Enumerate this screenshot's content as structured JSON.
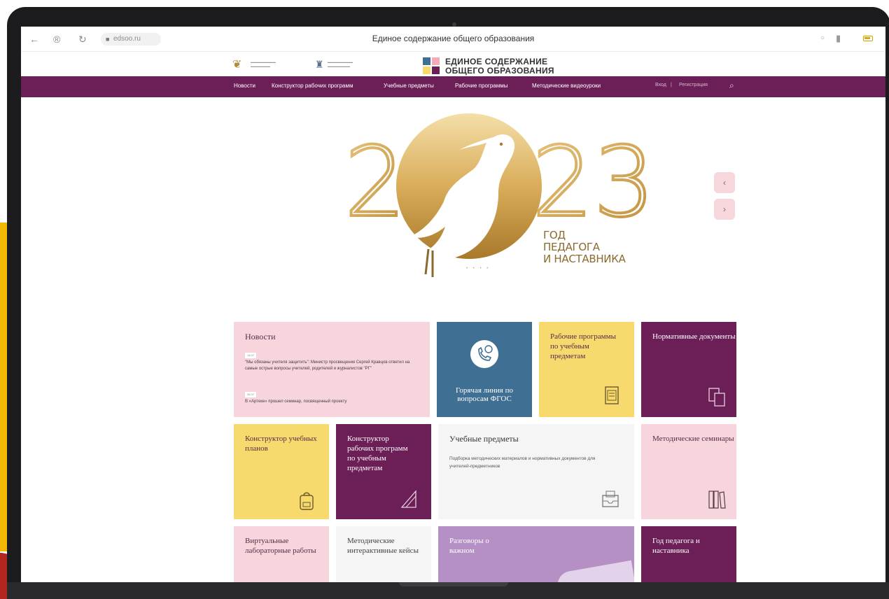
{
  "browser": {
    "url": "edsoo.ru",
    "page_title": "Единое содержание общего образования"
  },
  "header": {
    "logo_main_line1": "ЕДИНОЕ СОДЕРЖАНИЕ",
    "logo_main_line2": "ОБЩЕГО ОБРАЗОВАНИЯ"
  },
  "nav": {
    "items": [
      "Новости",
      "Конструктор рабочих программ",
      "Учебные предметы",
      "Рабочие программы",
      "Методические видеоуроки"
    ],
    "login": "Вход",
    "divider": "|",
    "register": "Регистрация"
  },
  "hero": {
    "year_left": "2",
    "year_right": "23",
    "caption_line1": "ГОД",
    "caption_line2": "ПЕДАГОГА",
    "caption_line3": "И НАСТАВНИКА",
    "prev": "‹",
    "next": "›",
    "dots": "• • • •"
  },
  "tiles": {
    "news": {
      "title": "Новости",
      "items": [
        {
          "date": "14.07",
          "text": "\"Мы обязаны учителя защитить\": Министр просвещения Сергей Кравцов ответил на самые острые вопросы учителей, родителей и журналистов \"РГ\""
        },
        {
          "date": "06.07",
          "text": "В «Артеке» прошел семинар, посвященный проекту"
        }
      ]
    },
    "hotline": {
      "title": "Горячая линия по вопросам ФГОС"
    },
    "work_programs": {
      "title": "Рабочие программы по учебным предметам"
    },
    "normative": {
      "title": "Нормативные документы"
    },
    "curriculum_constructor": {
      "title": "Конструктор учебных планов"
    },
    "program_constructor": {
      "title": "Конструктор рабочих программ по учебным предметам"
    },
    "subjects": {
      "title": "Учебные предметы",
      "description": "Подборка методических материалов и нормативных документов для учителей-предметников"
    },
    "seminars": {
      "title": "Методические семинары"
    },
    "virtual_labs": {
      "title": "Виртуальные лабораторные работы"
    },
    "interactive_cases": {
      "title": "Методические интерактивные кейсы"
    },
    "exam": {
      "title": "Разговоры о важном"
    },
    "year_teacher": {
      "title": "Год педагога и наставника"
    }
  },
  "colors": {
    "brand_purple": "#6c1f57",
    "tile_pink": "#f6d6dc",
    "tile_blue": "#3f6f93",
    "tile_yellow": "#f7d96e",
    "tile_lilac": "#b590c5",
    "gold": "#c79a3e"
  }
}
